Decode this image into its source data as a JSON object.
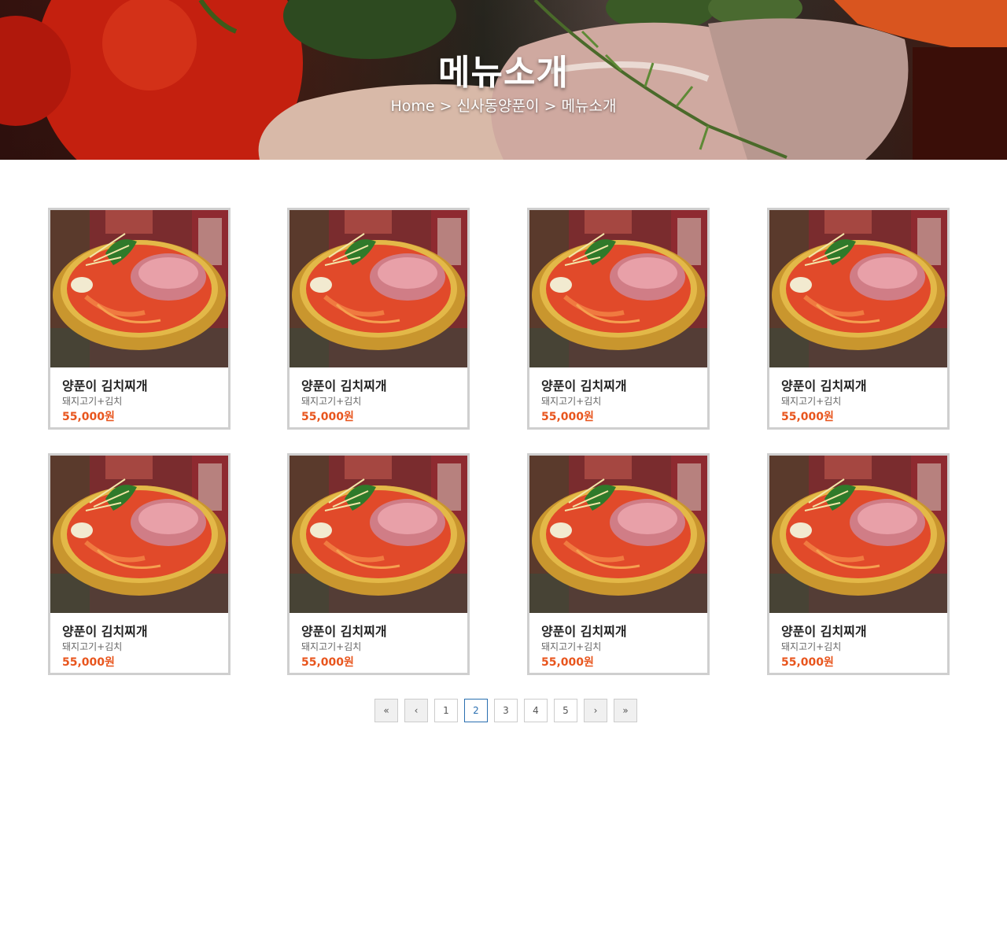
{
  "header": {
    "title": "메뉴소개",
    "breadcrumb": {
      "home": "Home",
      "separator": ">",
      "section": "신사동양푼이",
      "current": "메뉴소개"
    }
  },
  "menu": {
    "items": [
      {
        "name": "양푼이 김치찌개",
        "description": "돼지고기+김치",
        "price": "55,000원",
        "image": "kimchi-stew-photo"
      },
      {
        "name": "양푼이 김치찌개",
        "description": "돼지고기+김치",
        "price": "55,000원",
        "image": "kimchi-stew-photo"
      },
      {
        "name": "양푼이 김치찌개",
        "description": "돼지고기+김치",
        "price": "55,000원",
        "image": "kimchi-stew-photo"
      },
      {
        "name": "양푼이 김치찌개",
        "description": "돼지고기+김치",
        "price": "55,000원",
        "image": "kimchi-stew-photo"
      },
      {
        "name": "양푼이 김치찌개",
        "description": "돼지고기+김치",
        "price": "55,000원",
        "image": "kimchi-stew-photo"
      },
      {
        "name": "양푼이 김치찌개",
        "description": "돼지고기+김치",
        "price": "55,000원",
        "image": "kimchi-stew-photo"
      },
      {
        "name": "양푼이 김치찌개",
        "description": "돼지고기+김치",
        "price": "55,000원",
        "image": "kimchi-stew-photo"
      },
      {
        "name": "양푼이 김치찌개",
        "description": "돼지고기+김치",
        "price": "55,000원",
        "image": "kimchi-stew-photo"
      }
    ]
  },
  "pagination": {
    "first": "«",
    "prev": "‹",
    "pages": [
      "1",
      "2",
      "3",
      "4",
      "5"
    ],
    "current": "2",
    "next": "›",
    "last": "»"
  },
  "colors": {
    "price": "#e8551d",
    "card_border": "#cfcfcf",
    "active_page": "#2a6fb0"
  }
}
